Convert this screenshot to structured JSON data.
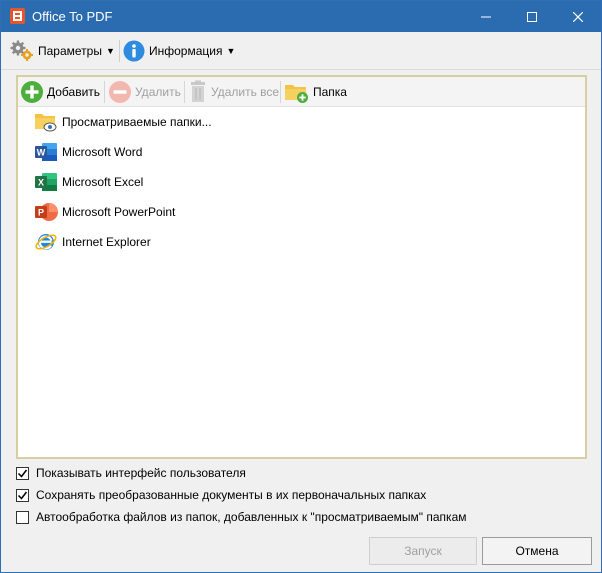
{
  "window": {
    "title": "Office To PDF"
  },
  "menu": {
    "settings_label": "Параметры",
    "info_label": "Информация"
  },
  "toolbar": {
    "add_label": "Добавить",
    "remove_label": "Удалить",
    "remove_all_label": "Удалить все",
    "folder_label": "Папка"
  },
  "list": {
    "items": [
      {
        "label": "Просматриваемые папки...",
        "icon": "watched-folder-icon"
      },
      {
        "label": "Microsoft Word",
        "icon": "word-icon"
      },
      {
        "label": "Microsoft Excel",
        "icon": "excel-icon"
      },
      {
        "label": "Microsoft PowerPoint",
        "icon": "powerpoint-icon"
      },
      {
        "label": "Internet Explorer",
        "icon": "internet-explorer-icon"
      }
    ]
  },
  "options": [
    {
      "label": "Показывать интерфейс пользователя",
      "checked": true
    },
    {
      "label": "Сохранять преобразованные документы в их первоначальных папках",
      "checked": true
    },
    {
      "label": "Автообработка файлов из папок, добавленных к \"просматриваемым\" папкам",
      "checked": false
    }
  ],
  "buttons": {
    "start_label": "Запуск",
    "cancel_label": "Отмена"
  },
  "colors": {
    "titlebar": "#2b6cb0",
    "word": "#2b579a",
    "excel": "#217346",
    "powerpoint": "#d24726",
    "folder": "#f3c443"
  }
}
